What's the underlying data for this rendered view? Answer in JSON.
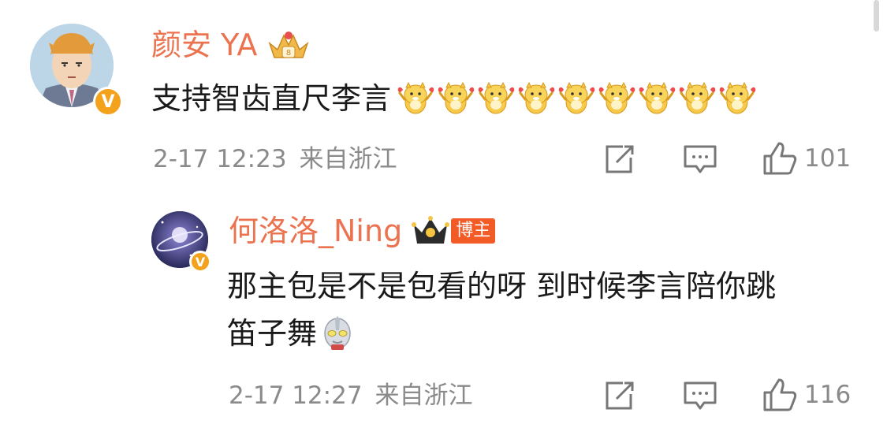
{
  "comments": [
    {
      "username": "颜安 YA",
      "content": "支持智齿直尺李言",
      "emoji_count": 9,
      "emoji_name": "hamster-cheer-emoji",
      "time": "2-17 12:23",
      "location": "来自浙江",
      "likes": "101",
      "verified_badge": "V"
    },
    {
      "username": "何洛洛_Ning",
      "tag": "博主",
      "content_line1": "那主包是不是包看的呀 到时候李言陪你跳",
      "content_line2": "笛子舞",
      "emoji_name": "ultraman-emoji",
      "time": "2-17 12:27",
      "location": "来自浙江",
      "likes": "116",
      "verified_badge": "V"
    }
  ],
  "colors": {
    "username": "#eb7350",
    "meta": "#8a8a8a",
    "badge": "#f4a21c",
    "tag": "#f25a26"
  }
}
